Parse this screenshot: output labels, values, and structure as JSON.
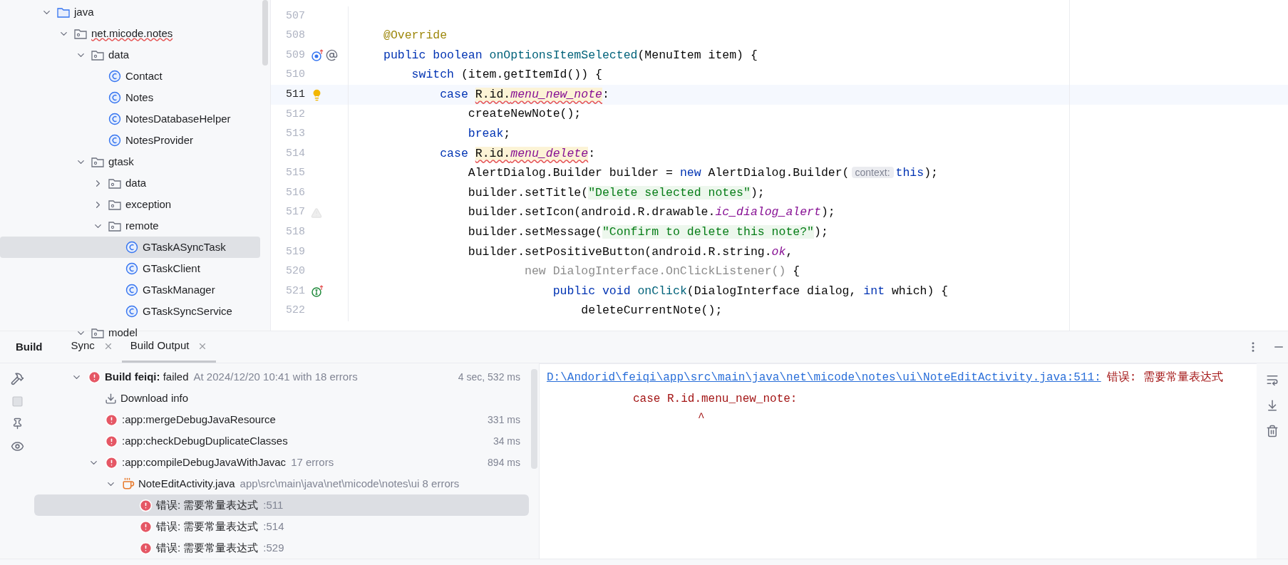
{
  "project_tree": [
    {
      "label": "java",
      "kind": "source-root",
      "expanded": true,
      "selected": false,
      "children": [
        {
          "label": "net.micode.notes",
          "kind": "package",
          "expanded": true,
          "selected": false,
          "error": true,
          "children": [
            {
              "label": "data",
              "kind": "package",
              "expanded": true,
              "selected": false,
              "children": [
                {
                  "label": "Contact",
                  "kind": "class",
                  "selected": false
                },
                {
                  "label": "Notes",
                  "kind": "class",
                  "selected": false
                },
                {
                  "label": "NotesDatabaseHelper",
                  "kind": "class",
                  "selected": false
                },
                {
                  "label": "NotesProvider",
                  "kind": "class",
                  "selected": false
                }
              ]
            },
            {
              "label": "gtask",
              "kind": "package",
              "expanded": true,
              "selected": false,
              "children": [
                {
                  "label": "data",
                  "kind": "package",
                  "expanded": false,
                  "selected": false
                },
                {
                  "label": "exception",
                  "kind": "package",
                  "expanded": false,
                  "selected": false
                },
                {
                  "label": "remote",
                  "kind": "package",
                  "expanded": true,
                  "selected": false,
                  "children": [
                    {
                      "label": "GTaskASyncTask",
                      "kind": "class",
                      "selected": true
                    },
                    {
                      "label": "GTaskClient",
                      "kind": "class",
                      "selected": false
                    },
                    {
                      "label": "GTaskManager",
                      "kind": "class",
                      "selected": false
                    },
                    {
                      "label": "GTaskSyncService",
                      "kind": "class",
                      "selected": false
                    }
                  ]
                }
              ]
            },
            {
              "label": "model",
              "kind": "package",
              "expanded": true,
              "selected": false
            }
          ]
        }
      ]
    }
  ],
  "editor": {
    "lines": [
      {
        "number": "507",
        "current": false
      },
      {
        "number": "508",
        "current": false,
        "tokens": [
          {
            "text": "@Override",
            "kind": "annotation"
          }
        ]
      },
      {
        "number": "509",
        "current": false,
        "gutter": {
          "kind": "overrides"
        },
        "tokens": [
          {
            "text": "public boolean ",
            "kind": "keyword"
          },
          {
            "text": "onOptionsItemSelected",
            "kind": "method"
          },
          {
            "text": "(MenuItem item) {",
            "kind": "plain"
          }
        ]
      },
      {
        "number": "510",
        "current": false,
        "tokens": [
          {
            "text": "    switch ",
            "kind": "keyword"
          },
          {
            "text": "(item.getItemId()) {",
            "kind": "plain"
          }
        ]
      },
      {
        "number": "511",
        "current": true,
        "gutter": {
          "kind": "bulb"
        },
        "tokens": [
          {
            "text": "        case ",
            "kind": "keyword"
          },
          {
            "text": "R.id.",
            "kind": "plain",
            "error": true
          },
          {
            "text": "menu_new_note",
            "kind": "field",
            "error": true
          },
          {
            "text": ":",
            "kind": "plain"
          }
        ]
      },
      {
        "number": "512",
        "current": false,
        "tokens": [
          {
            "text": "            createNewNote();",
            "kind": "plain"
          }
        ]
      },
      {
        "number": "513",
        "current": false,
        "tokens": [
          {
            "text": "            break",
            "kind": "keyword"
          },
          {
            "text": ";",
            "kind": "plain"
          }
        ]
      },
      {
        "number": "514",
        "current": false,
        "tokens": [
          {
            "text": "        case ",
            "kind": "keyword"
          },
          {
            "text": "R.id.",
            "kind": "plain",
            "error": true
          },
          {
            "text": "menu_delete",
            "kind": "field",
            "error": true
          },
          {
            "text": ":",
            "kind": "plain"
          }
        ]
      },
      {
        "number": "515",
        "current": false,
        "tokens": [
          {
            "text": "            AlertDialog.Builder builder = ",
            "kind": "plain"
          },
          {
            "text": "new ",
            "kind": "keyword"
          },
          {
            "text": "AlertDialog.Builder(",
            "kind": "plain"
          },
          {
            "text": "context:",
            "kind": "hint"
          },
          {
            "text": "this",
            "kind": "keyword"
          },
          {
            "text": ");",
            "kind": "plain"
          }
        ]
      },
      {
        "number": "516",
        "current": false,
        "tokens": [
          {
            "text": "            builder.setTitle(",
            "kind": "plain"
          },
          {
            "text": "\"Delete selected notes\"",
            "kind": "string"
          },
          {
            "text": ");",
            "kind": "plain"
          }
        ]
      },
      {
        "number": "517",
        "current": false,
        "gutter": {
          "kind": "warning"
        },
        "tokens": [
          {
            "text": "            builder.setIcon(android.R.drawable.",
            "kind": "plain"
          },
          {
            "text": "ic_dialog_alert",
            "kind": "field"
          },
          {
            "text": ");",
            "kind": "plain"
          }
        ]
      },
      {
        "number": "518",
        "current": false,
        "tokens": [
          {
            "text": "            builder.setMessage(",
            "kind": "plain"
          },
          {
            "text": "\"Confirm to delete this note?\"",
            "kind": "string"
          },
          {
            "text": ");",
            "kind": "plain"
          }
        ]
      },
      {
        "number": "519",
        "current": false,
        "tokens": [
          {
            "text": "            builder.setPositiveButton(android.R.string.",
            "kind": "plain"
          },
          {
            "text": "ok",
            "kind": "field"
          },
          {
            "text": ",",
            "kind": "plain"
          }
        ]
      },
      {
        "number": "520",
        "current": false,
        "tokens": [
          {
            "text": "                    new DialogInterface.OnClickListener() ",
            "kind": "dim"
          },
          {
            "text": "{",
            "kind": "plain"
          }
        ]
      },
      {
        "number": "521",
        "current": false,
        "gutter": {
          "kind": "implements"
        },
        "tokens": [
          {
            "text": "                        public void ",
            "kind": "keyword"
          },
          {
            "text": "onClick",
            "kind": "method"
          },
          {
            "text": "(DialogInterface dialog, ",
            "kind": "plain"
          },
          {
            "text": "int ",
            "kind": "keyword"
          },
          {
            "text": "which) {",
            "kind": "plain"
          }
        ]
      },
      {
        "number": "522",
        "current": false,
        "tokens": [
          {
            "text": "                            deleteCurrentNote();",
            "kind": "plain"
          }
        ]
      }
    ]
  },
  "build_panel": {
    "title": "Build",
    "tabs": [
      {
        "label": "Sync",
        "selected": false
      },
      {
        "label": "Build Output",
        "selected": true
      }
    ],
    "tree": [
      {
        "kind": "error",
        "text": "**Build feiqi:** failed",
        "detail": "At 2024/12/20 10:41 with 18 errors",
        "duration": "4 sec, 532 ms",
        "expanded": true,
        "selected": false,
        "children": [
          {
            "kind": "download",
            "text": "Download info",
            "selected": false
          },
          {
            "kind": "error",
            "text": ":app:mergeDebugJavaResource",
            "duration": "331 ms",
            "selected": false
          },
          {
            "kind": "error",
            "text": ":app:checkDebugDuplicateClasses",
            "duration": "34 ms",
            "selected": false
          },
          {
            "kind": "error",
            "text": ":app:compileDebugJavaWithJavac",
            "detail": "17 errors",
            "duration": "894 ms",
            "expanded": true,
            "selected": false,
            "children": [
              {
                "kind": "file",
                "text": "NoteEditActivity.java",
                "detail": "app\\src\\main\\java\\net\\micode\\notes\\ui 8 errors",
                "expanded": true,
                "selected": false,
                "children": [
                  {
                    "kind": "error",
                    "text": "错误: 需要常量表达式",
                    "detail": ":511",
                    "selected": true
                  },
                  {
                    "kind": "error",
                    "text": "错误: 需要常量表达式",
                    "detail": ":514",
                    "selected": false
                  },
                  {
                    "kind": "error",
                    "text": "错误: 需要常量表达式",
                    "detail": ":529",
                    "selected": false
                  }
                ]
              }
            ]
          }
        ]
      }
    ],
    "output": {
      "link": "D:\\Andorid\\feiqi\\app\\src\\main\\java\\net\\micode\\notes\\ui\\NoteEditActivity.java:511:",
      "message": "错误: 需要常量表达式",
      "code": "case R.id.menu_new_note:",
      "caret": "^"
    }
  }
}
